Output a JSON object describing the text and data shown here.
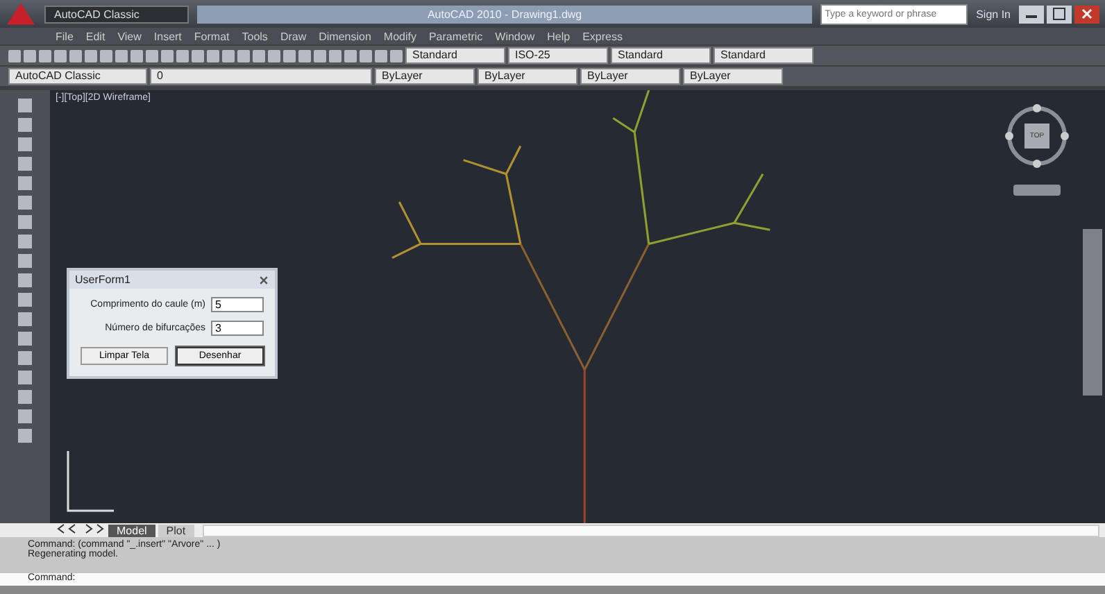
{
  "title_bar": {
    "workspace": "AutoCAD Classic",
    "title": "AutoCAD 2010 - Drawing1.dwg",
    "search_placeholder": "Type a keyword or phrase",
    "sign_in": "Sign In"
  },
  "menu": [
    "File",
    "Edit",
    "View",
    "Insert",
    "Format",
    "Tools",
    "Draw",
    "Dimension",
    "Modify",
    "Parametric",
    "Window",
    "Help",
    "Express"
  ],
  "toolbar_top": {
    "text_style": "Standard",
    "dim_style": "ISO-25",
    "table_style": "Standard",
    "mleader_style": "Standard"
  },
  "toolbar_bottom": {
    "workspace": "AutoCAD Classic",
    "layer": "0",
    "object_color": "ByLayer",
    "linetype": "ByLayer",
    "lineweight": "ByLayer",
    "plot_style": "ByLayer"
  },
  "viewport_label": "[-][Top][2D Wireframe]",
  "viewcube": {
    "face": "TOP"
  },
  "dialog": {
    "title": "UserForm1",
    "fields": [
      {
        "label": "Comprimento do caule (m)",
        "value": "5"
      },
      {
        "label": "Número de bifurcações",
        "value": "3"
      }
    ],
    "buttons": [
      {
        "label": "Limpar Tela",
        "selected": false
      },
      {
        "label": "Desenhar",
        "selected": true
      }
    ]
  },
  "layout_tabs": [
    {
      "label": "Model",
      "selected": true
    },
    {
      "label": "Plot",
      "selected": false
    }
  ],
  "command_history": [
    "Command: (command \"_.insert\" \"Arvore\" ... )",
    "Regenerating model."
  ],
  "command_prompt": "Command:"
}
